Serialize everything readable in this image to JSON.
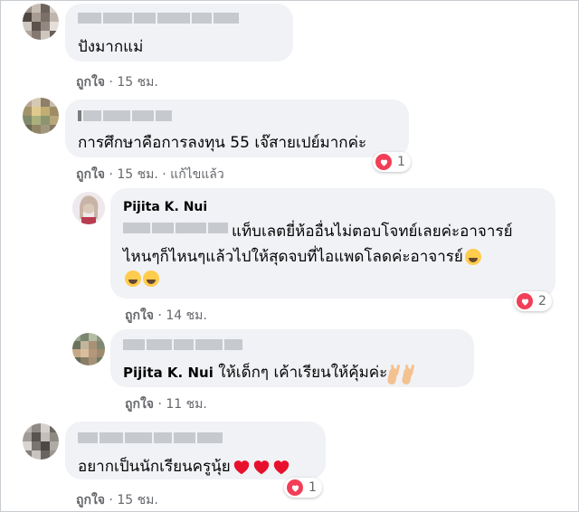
{
  "comments": [
    {
      "text": "ปังมากแม่",
      "actions": {
        "like": "ถูกใจ",
        "sep": "·",
        "time": "15 ชม."
      }
    },
    {
      "text": "การศึกษาคือการลงทุน 55 เจ๊สายเปย์มากค่ะ",
      "actions": {
        "like": "ถูกใจ",
        "sep": "·",
        "time": "15 ชม.",
        "sep2": "·",
        "edited": "แก้ไขแล้ว"
      },
      "reaction_count": "1"
    },
    {
      "name": "Pijita K. Nui",
      "line1": "แท็บเลตยี่ห้ออื่นไม่ตอบโจทย์เลยค่ะอาจารย์",
      "line2": "ไหนๆก็ไหนๆแล้วไปให้สุดจบที่ไอแพดโลดค่ะอาจารย์",
      "actions": {
        "like": "ถูกใจ",
        "sep": "·",
        "time": "14 ชม."
      },
      "reaction_count": "2"
    },
    {
      "tag_name": "Pijita K. Nui",
      "text": "ให้เด็กๆ เค้าเรียนให้คุ้มค่ะ",
      "actions": {
        "like": "ถูกใจ",
        "sep": "·",
        "time": "11 ชม."
      }
    },
    {
      "text": "อยากเป็นนักเรียนครูนุ้ย",
      "actions": {
        "like": "ถูกใจ",
        "sep": "·",
        "time": "15 ชม."
      },
      "reaction_count": "1"
    }
  ],
  "icons": {
    "reaction": "heart-reaction-icon",
    "emoji_laugh": "rolling-laughing-emoji-icon",
    "emoji_peace": "victory-hand-emoji-icon",
    "emoji_heart": "red-heart-emoji-icon"
  },
  "colors": {
    "bubble": "#f0f2f5",
    "meta": "#65676b",
    "heart": "#f33e58"
  }
}
